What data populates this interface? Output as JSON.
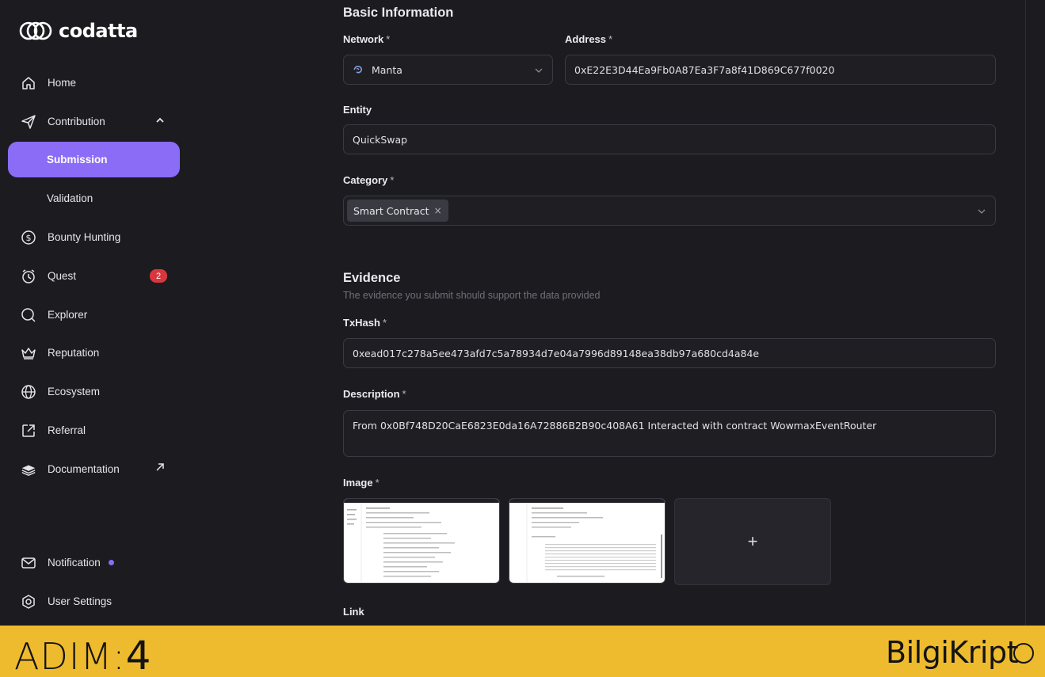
{
  "app": {
    "logo_text": "codatta"
  },
  "sidebar": {
    "items": [
      {
        "label": "Home",
        "icon": "home-icon"
      },
      {
        "label": "Contribution",
        "icon": "send-icon"
      },
      {
        "label": "Submission"
      },
      {
        "label": "Validation"
      },
      {
        "label": "Bounty Hunting",
        "icon": "dollar-icon"
      },
      {
        "label": "Quest",
        "icon": "alarm-clock-icon",
        "badge": "2"
      },
      {
        "label": "Explorer",
        "icon": "search-icon"
      },
      {
        "label": "Reputation",
        "icon": "crown-icon"
      },
      {
        "label": "Ecosystem",
        "icon": "globe-icon"
      },
      {
        "label": "Referral",
        "icon": "share-icon"
      },
      {
        "label": "Documentation",
        "icon": "book-icon"
      }
    ],
    "bottom": [
      {
        "label": "Notification",
        "icon": "mail-icon"
      },
      {
        "label": "User Settings",
        "icon": "settings-icon"
      }
    ],
    "active_color": "#8b6cf6"
  },
  "form": {
    "basic_title": "Basic Information",
    "network_label": "Network",
    "network_value": "Manta",
    "address_label": "Address",
    "address_value": "0xE22E3D44Ea9Fb0A87Ea3F7a8f41D869C677f0020",
    "entity_label": "Entity",
    "entity_value": "QuickSwap",
    "category_label": "Category",
    "category_tag": "Smart Contract",
    "evidence_title": "Evidence",
    "evidence_sub": "The evidence you submit should support the data provided",
    "txhash_label": "TxHash",
    "txhash_value": "0xead017c278a5ee473afd7c5a78934d7e04a7996d89148ea38db97a680cd4a84e",
    "description_label": "Description",
    "description_value": "From 0x0Bf748D20CaE6823E0da16A72886B2B90c408A61 Interacted with contract WowmaxEventRouter",
    "image_label": "Image",
    "link_label": "Link",
    "required_mark": "*",
    "upload_plus": "+"
  },
  "banner": {
    "left_text": "ADIM:",
    "left_num": "4",
    "right_text": "BilgiKript",
    "color": "#efbb2e"
  }
}
